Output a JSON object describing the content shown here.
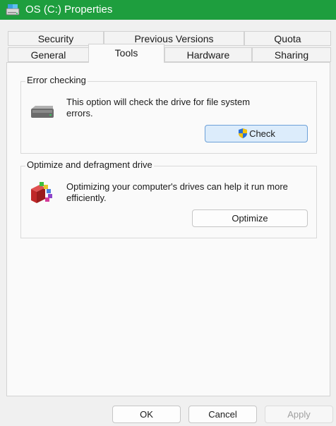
{
  "window": {
    "title": "OS (C:) Properties",
    "accent_color": "#1e9e3e",
    "icon": "drive-properties-icon"
  },
  "tabs_back_row": [
    {
      "label": "Security"
    },
    {
      "label": "Previous Versions"
    },
    {
      "label": "Quota"
    }
  ],
  "tabs_front_row": [
    {
      "label": "General"
    },
    {
      "label": "Tools",
      "active": true
    },
    {
      "label": "Hardware"
    },
    {
      "label": "Sharing"
    }
  ],
  "error_checking": {
    "group_label": "Error checking",
    "description": "This option will check the drive for file system errors.",
    "icon": "hard-drive-icon",
    "button_label": "Check",
    "button_icon": "uac-shield-icon"
  },
  "optimize": {
    "group_label": "Optimize and defragment drive",
    "description": "Optimizing your computer's drives can help it run more efficiently.",
    "icon": "defrag-icon",
    "button_label": "Optimize"
  },
  "footer": {
    "ok_label": "OK",
    "cancel_label": "Cancel",
    "apply_label": "Apply"
  }
}
